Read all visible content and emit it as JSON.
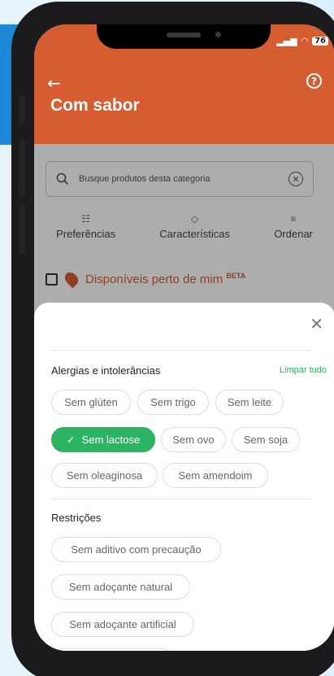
{
  "status": {
    "battery": "76"
  },
  "header": {
    "title": "Com sabor"
  },
  "search": {
    "placeholder": "Busque produtos desta categoria"
  },
  "filters": [
    {
      "label": "Preferências",
      "icon": "sliders-icon"
    },
    {
      "label": "Características",
      "icon": "tag-icon"
    },
    {
      "label": "Ordenar",
      "icon": "sort-icon"
    }
  ],
  "nearby": {
    "label": "Disponíveis perto de mim",
    "badge": "BETA"
  },
  "sheet": {
    "allergies": {
      "title": "Alergias e intolerâncias",
      "clear_label": "Limpar tudo",
      "chips": [
        {
          "label": "Sem glúten",
          "selected": false
        },
        {
          "label": "Sem trigo",
          "selected": false
        },
        {
          "label": "Sem leite",
          "selected": false
        },
        {
          "label": "Sem lactose",
          "selected": true
        },
        {
          "label": "Sem ovo",
          "selected": false
        },
        {
          "label": "Sem soja",
          "selected": false
        },
        {
          "label": "Sem oleaginosa",
          "selected": false
        },
        {
          "label": "Sem amendoim",
          "selected": false
        }
      ]
    },
    "restrictions": {
      "title": "Restrições",
      "chips": [
        {
          "label": "Sem aditivo com precaução",
          "selected": false
        },
        {
          "label": "Sem adoçante natural",
          "selected": false
        },
        {
          "label": "Sem adoçante artificial",
          "selected": false
        }
      ]
    }
  },
  "colors": {
    "accent": "#d65c32",
    "selected": "#2bb461"
  }
}
